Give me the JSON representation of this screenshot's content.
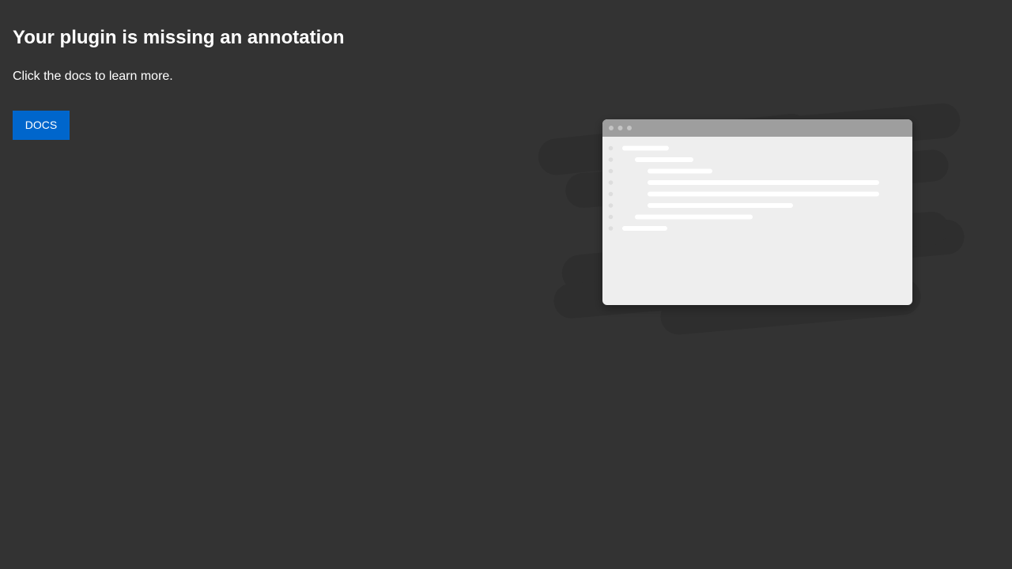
{
  "page": {
    "title": "Your plugin is missing an annotation",
    "subtitle": "Click the docs to learn more."
  },
  "actions": {
    "docs_label": "DOCS"
  },
  "colors": {
    "background": "#333333",
    "button": "#0066cc",
    "window_titlebar": "#9e9e9e",
    "window_body": "#eeeeee",
    "shadow_blob": "#2e2e2e"
  },
  "icons": {
    "illustration": "code-editor-window-illustration"
  }
}
